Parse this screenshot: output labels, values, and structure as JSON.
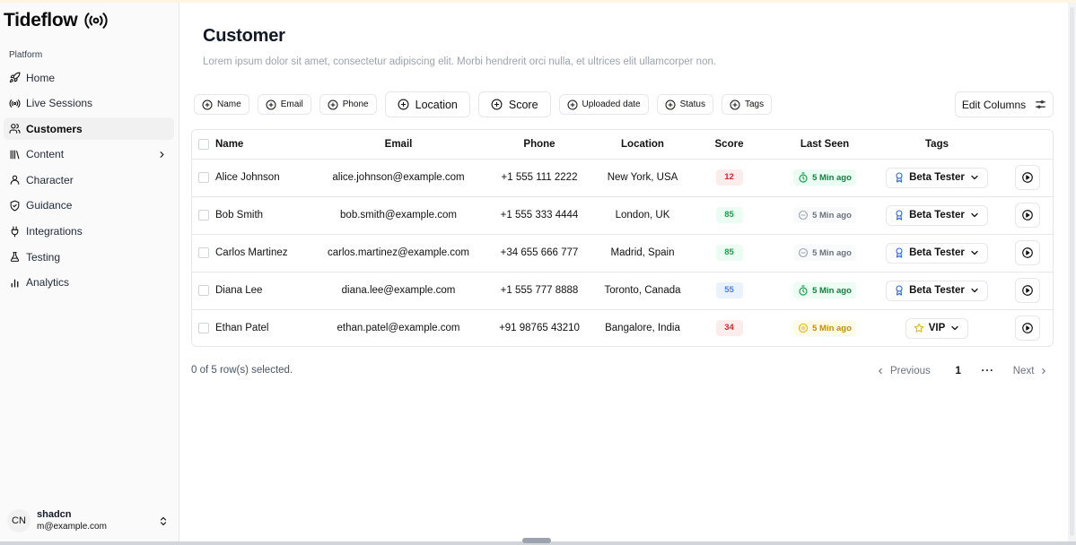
{
  "app": {
    "brand": "Tideflow",
    "section_label": "Platform"
  },
  "sidebar": {
    "items": [
      {
        "label": "Home",
        "icon": "rocket-icon"
      },
      {
        "label": "Live Sessions",
        "icon": "broadcast-icon"
      },
      {
        "label": "Customers",
        "icon": "users-icon",
        "active": true
      },
      {
        "label": "Content",
        "icon": "library-icon",
        "has_children": true
      },
      {
        "label": "Character",
        "icon": "user-icon"
      },
      {
        "label": "Guidance",
        "icon": "shield-icon"
      },
      {
        "label": "Integrations",
        "icon": "plug-icon"
      },
      {
        "label": "Testing",
        "icon": "flask-icon"
      },
      {
        "label": "Analytics",
        "icon": "bar-chart-icon"
      }
    ]
  },
  "user": {
    "initials": "CN",
    "name": "shadcn",
    "email": "m@example.com"
  },
  "page": {
    "title": "Customer",
    "subtitle": "Lorem ipsum dolor sit amet, consectetur adipiscing elit. Morbi hendrerit orci nulla, et ultrices elit ullamcorper non."
  },
  "filters": [
    "Name",
    "Email",
    "Phone",
    "Location",
    "Score",
    "Uploaded date",
    "Status",
    "Tags"
  ],
  "edit_columns_label": "Edit Columns",
  "table": {
    "headers": {
      "name": "Name",
      "email": "Email",
      "phone": "Phone",
      "location": "Location",
      "score": "Score",
      "last_seen": "Last Seen",
      "tags": "Tags"
    },
    "rows": [
      {
        "name": "Alice Johnson",
        "email": "alice.johnson@example.com",
        "phone": "+1 555 111 2222",
        "location": "New York, USA",
        "score": "12",
        "last_seen": "5 Min ago",
        "tag": "Beta Tester"
      },
      {
        "name": "Bob Smith",
        "email": "bob.smith@example.com",
        "phone": "+1 555 333 4444",
        "location": "London, UK",
        "score": "85",
        "last_seen": "5 Min ago",
        "tag": "Beta Tester"
      },
      {
        "name": "Carlos Martinez",
        "email": "carlos.martinez@example.com",
        "phone": "+34 655 666 777",
        "location": "Madrid, Spain",
        "score": "85",
        "last_seen": "5 Min ago",
        "tag": "Beta Tester"
      },
      {
        "name": "Diana Lee",
        "email": "diana.lee@example.com",
        "phone": "+1 555 777 8888",
        "location": "Toronto, Canada",
        "score": "55",
        "last_seen": "5 Min ago",
        "tag": "Beta Tester"
      },
      {
        "name": "Ethan Patel",
        "email": "ethan.patel@example.com",
        "phone": "+91 98765 43210",
        "location": "Bangalore, India",
        "score": "34",
        "last_seen": "5 Min ago",
        "tag": "VIP"
      }
    ]
  },
  "footer": {
    "selected_info": "0 of 5 row(s) selected.",
    "previous": "Previous",
    "page": "1",
    "ellipsis": "···",
    "next": "Next"
  },
  "colors": {
    "score_red_bg": "#fdecec",
    "score_red_text": "#dc2626",
    "score_green_bg": "#ecfdf3",
    "score_green_text": "#16a34a",
    "score_blue_bg": "#eaf2fe",
    "score_blue_text": "#3b82f6",
    "seen_green_bg": "#ecfdf3",
    "seen_green_text": "#15803d",
    "seen_gray_bg": "#f9fafb",
    "seen_gray_text": "#6b7280",
    "seen_amber_bg": "#fefce8",
    "seen_amber_text": "#ca8a04"
  }
}
